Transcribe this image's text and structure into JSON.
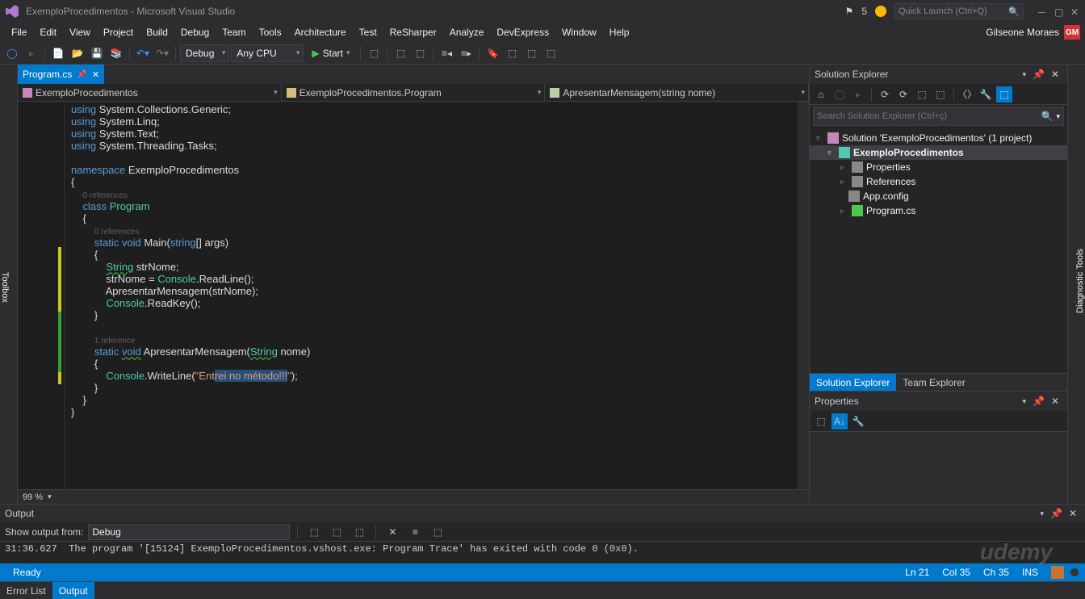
{
  "title_bar": {
    "title": "ExemploProcedimentos - Microsoft Visual Studio",
    "notification_count": "5",
    "quick_launch_placeholder": "Quick Launch (Ctrl+Q)"
  },
  "menu": {
    "items": [
      "File",
      "Edit",
      "View",
      "Project",
      "Build",
      "Debug",
      "Team",
      "Tools",
      "Architecture",
      "Test",
      "ReSharper",
      "Analyze",
      "DevExpress",
      "Window",
      "Help"
    ],
    "user": "Gilseone Moraes",
    "user_initials": "GM"
  },
  "toolbar": {
    "config": "Debug",
    "platform": "Any CPU",
    "start": "Start"
  },
  "editor": {
    "tab": "Program.cs",
    "context": {
      "project": "ExemploProcedimentos",
      "class": "ExemploProcedimentos.Program",
      "method": "ApresentarMensagem(string nome)"
    },
    "zoom": "99 %",
    "code_lines": [
      {
        "type": "code",
        "tokens": [
          [
            "kw",
            "using"
          ],
          [
            "ident",
            " System.Collections.Generic;"
          ]
        ]
      },
      {
        "type": "code",
        "tokens": [
          [
            "kw",
            "using"
          ],
          [
            "ident",
            " System.Linq;"
          ]
        ]
      },
      {
        "type": "code",
        "tokens": [
          [
            "kw",
            "using"
          ],
          [
            "ident",
            " System.Text;"
          ]
        ]
      },
      {
        "type": "code",
        "tokens": [
          [
            "kw",
            "using"
          ],
          [
            "ident",
            " System.Threading.Tasks;"
          ]
        ]
      },
      {
        "type": "blank"
      },
      {
        "type": "code",
        "tokens": [
          [
            "kw",
            "namespace"
          ],
          [
            "ident",
            " ExemploProcedimentos"
          ]
        ]
      },
      {
        "type": "code",
        "tokens": [
          [
            "ident",
            "{"
          ]
        ]
      },
      {
        "type": "ref",
        "indent": "    ",
        "text": "0 references"
      },
      {
        "type": "code",
        "tokens": [
          [
            "ident",
            "    "
          ],
          [
            "kw",
            "class"
          ],
          [
            "ident",
            " "
          ],
          [
            "str-type",
            "Program"
          ]
        ]
      },
      {
        "type": "code",
        "tokens": [
          [
            "ident",
            "    {"
          ]
        ]
      },
      {
        "type": "ref",
        "indent": "        ",
        "text": "0 references"
      },
      {
        "type": "code",
        "tokens": [
          [
            "ident",
            "        "
          ],
          [
            "kw",
            "static"
          ],
          [
            "ident",
            " "
          ],
          [
            "kw",
            "void"
          ],
          [
            "ident",
            " Main("
          ],
          [
            "kw",
            "string"
          ],
          [
            "ident",
            "[] args)"
          ]
        ]
      },
      {
        "type": "code",
        "tokens": [
          [
            "ident",
            "        {"
          ]
        ]
      },
      {
        "type": "code",
        "tokens": [
          [
            "ident",
            "            "
          ],
          [
            "str-type underline-wavy",
            "String"
          ],
          [
            "ident",
            " strNome;"
          ]
        ]
      },
      {
        "type": "code",
        "tokens": [
          [
            "ident",
            "            strNome = "
          ],
          [
            "str-type",
            "Console"
          ],
          [
            "ident",
            ".ReadLine();"
          ]
        ]
      },
      {
        "type": "code",
        "tokens": [
          [
            "ident",
            "            ApresentarMensagem(strNome);"
          ]
        ]
      },
      {
        "type": "code",
        "tokens": [
          [
            "ident",
            "            "
          ],
          [
            "str-type",
            "Console"
          ],
          [
            "ident",
            ".ReadKey();"
          ]
        ]
      },
      {
        "type": "code",
        "tokens": [
          [
            "ident",
            "        }"
          ]
        ]
      },
      {
        "type": "blank"
      },
      {
        "type": "ref",
        "indent": "        ",
        "text": "1 reference"
      },
      {
        "type": "code",
        "tokens": [
          [
            "ident",
            "        "
          ],
          [
            "kw",
            "static"
          ],
          [
            "ident",
            " "
          ],
          [
            "kw underline-wavy",
            "void"
          ],
          [
            "ident",
            " ApresentarMensagem("
          ],
          [
            "str-type underline-wavy",
            "String"
          ],
          [
            "ident",
            " nome)"
          ]
        ]
      },
      {
        "type": "code",
        "tokens": [
          [
            "ident",
            "        {"
          ]
        ]
      },
      {
        "type": "code",
        "tokens": [
          [
            "ident",
            "            "
          ],
          [
            "str-type",
            "Console"
          ],
          [
            "ident",
            ".WriteLine("
          ],
          [
            "string",
            "\"Ent"
          ],
          [
            "string selection",
            "rei no método!!!"
          ],
          [
            "string",
            "\""
          ],
          [
            "ident",
            ");"
          ]
        ]
      },
      {
        "type": "code",
        "tokens": [
          [
            "ident",
            "        }"
          ]
        ]
      },
      {
        "type": "code",
        "tokens": [
          [
            "ident",
            "    }"
          ]
        ]
      },
      {
        "type": "code",
        "tokens": [
          [
            "ident",
            "}"
          ]
        ]
      }
    ]
  },
  "solution_explorer": {
    "title": "Solution Explorer",
    "search_placeholder": "Search Solution Explorer (Ctrl+ç)",
    "solution": "Solution 'ExemploProcedimentos' (1 project)",
    "project": "ExemploProcedimentos",
    "nodes": [
      "Properties",
      "References",
      "App.config",
      "Program.cs"
    ],
    "tabs": [
      "Solution Explorer",
      "Team Explorer"
    ]
  },
  "properties": {
    "title": "Properties"
  },
  "output": {
    "title": "Output",
    "show_from_label": "Show output from:",
    "source": "Debug",
    "text": "31:36.627  The program '[15124] ExemploProcedimentos.vshost.exe: Program Trace' has exited with code 0 (0x0)."
  },
  "bottom_tabs": [
    "Error List",
    "Output"
  ],
  "status": {
    "ready": "Ready",
    "ln": "Ln 21",
    "col": "Col 35",
    "ch": "Ch 35",
    "ins": "INS"
  },
  "watermark": "udemy"
}
